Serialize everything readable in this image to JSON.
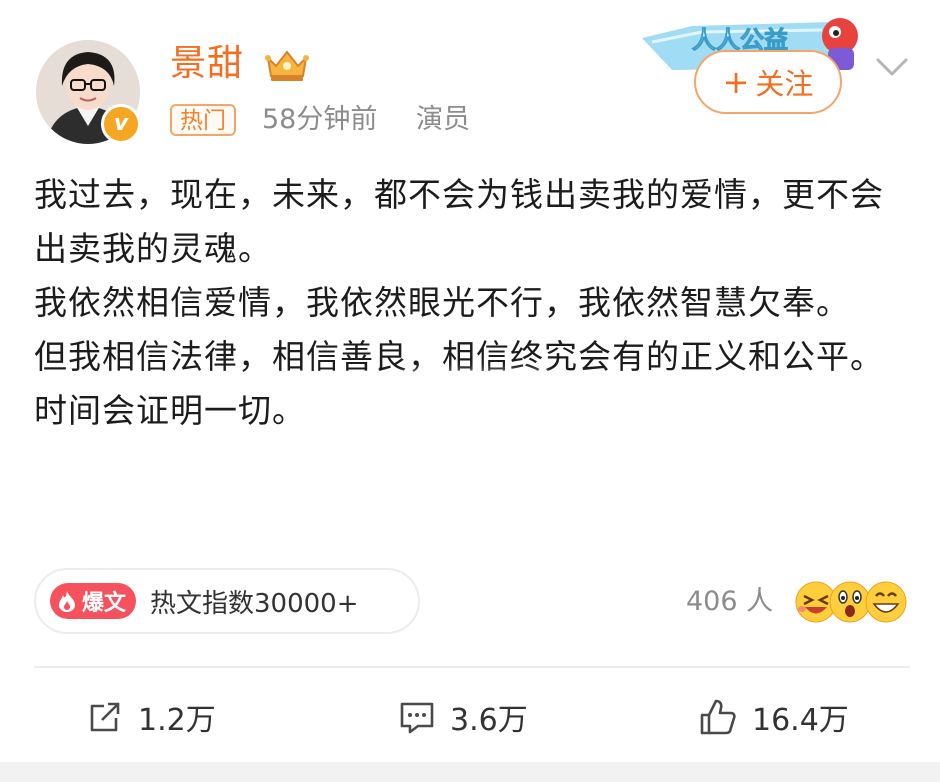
{
  "author": {
    "name": "景甜",
    "hot_tag": "热门",
    "time": "58分钟前",
    "source": "演员"
  },
  "header": {
    "follow_label": "关注",
    "follow_plus": "+",
    "promo_text": "人人公益"
  },
  "post": {
    "paragraphs": [
      "我过去，现在，未来，都不会为钱出卖我的爱情，更不会出卖我的灵魂。",
      "我依然相信爱情，我依然眼光不行，我依然智慧欠奉。",
      "但我相信法律，相信善良，相信终究会有的正义和公平。",
      "时间会证明一切。"
    ]
  },
  "hot_index": {
    "badge_label": "爆文",
    "text": "热文指数30000+"
  },
  "reactions": {
    "count_text": "406 人"
  },
  "actions": {
    "share_count": "1.2万",
    "comment_count": "3.6万",
    "like_count": "16.4万"
  },
  "colors": {
    "accent_orange": "#f56d1e",
    "explode_red": "#f5525d",
    "verify_gold": "#f5a623",
    "muted_text": "#8c8c8c"
  },
  "icons": [
    "crown-icon",
    "chevron-down-icon",
    "flame-icon",
    "share-icon",
    "comment-icon",
    "like-icon"
  ]
}
